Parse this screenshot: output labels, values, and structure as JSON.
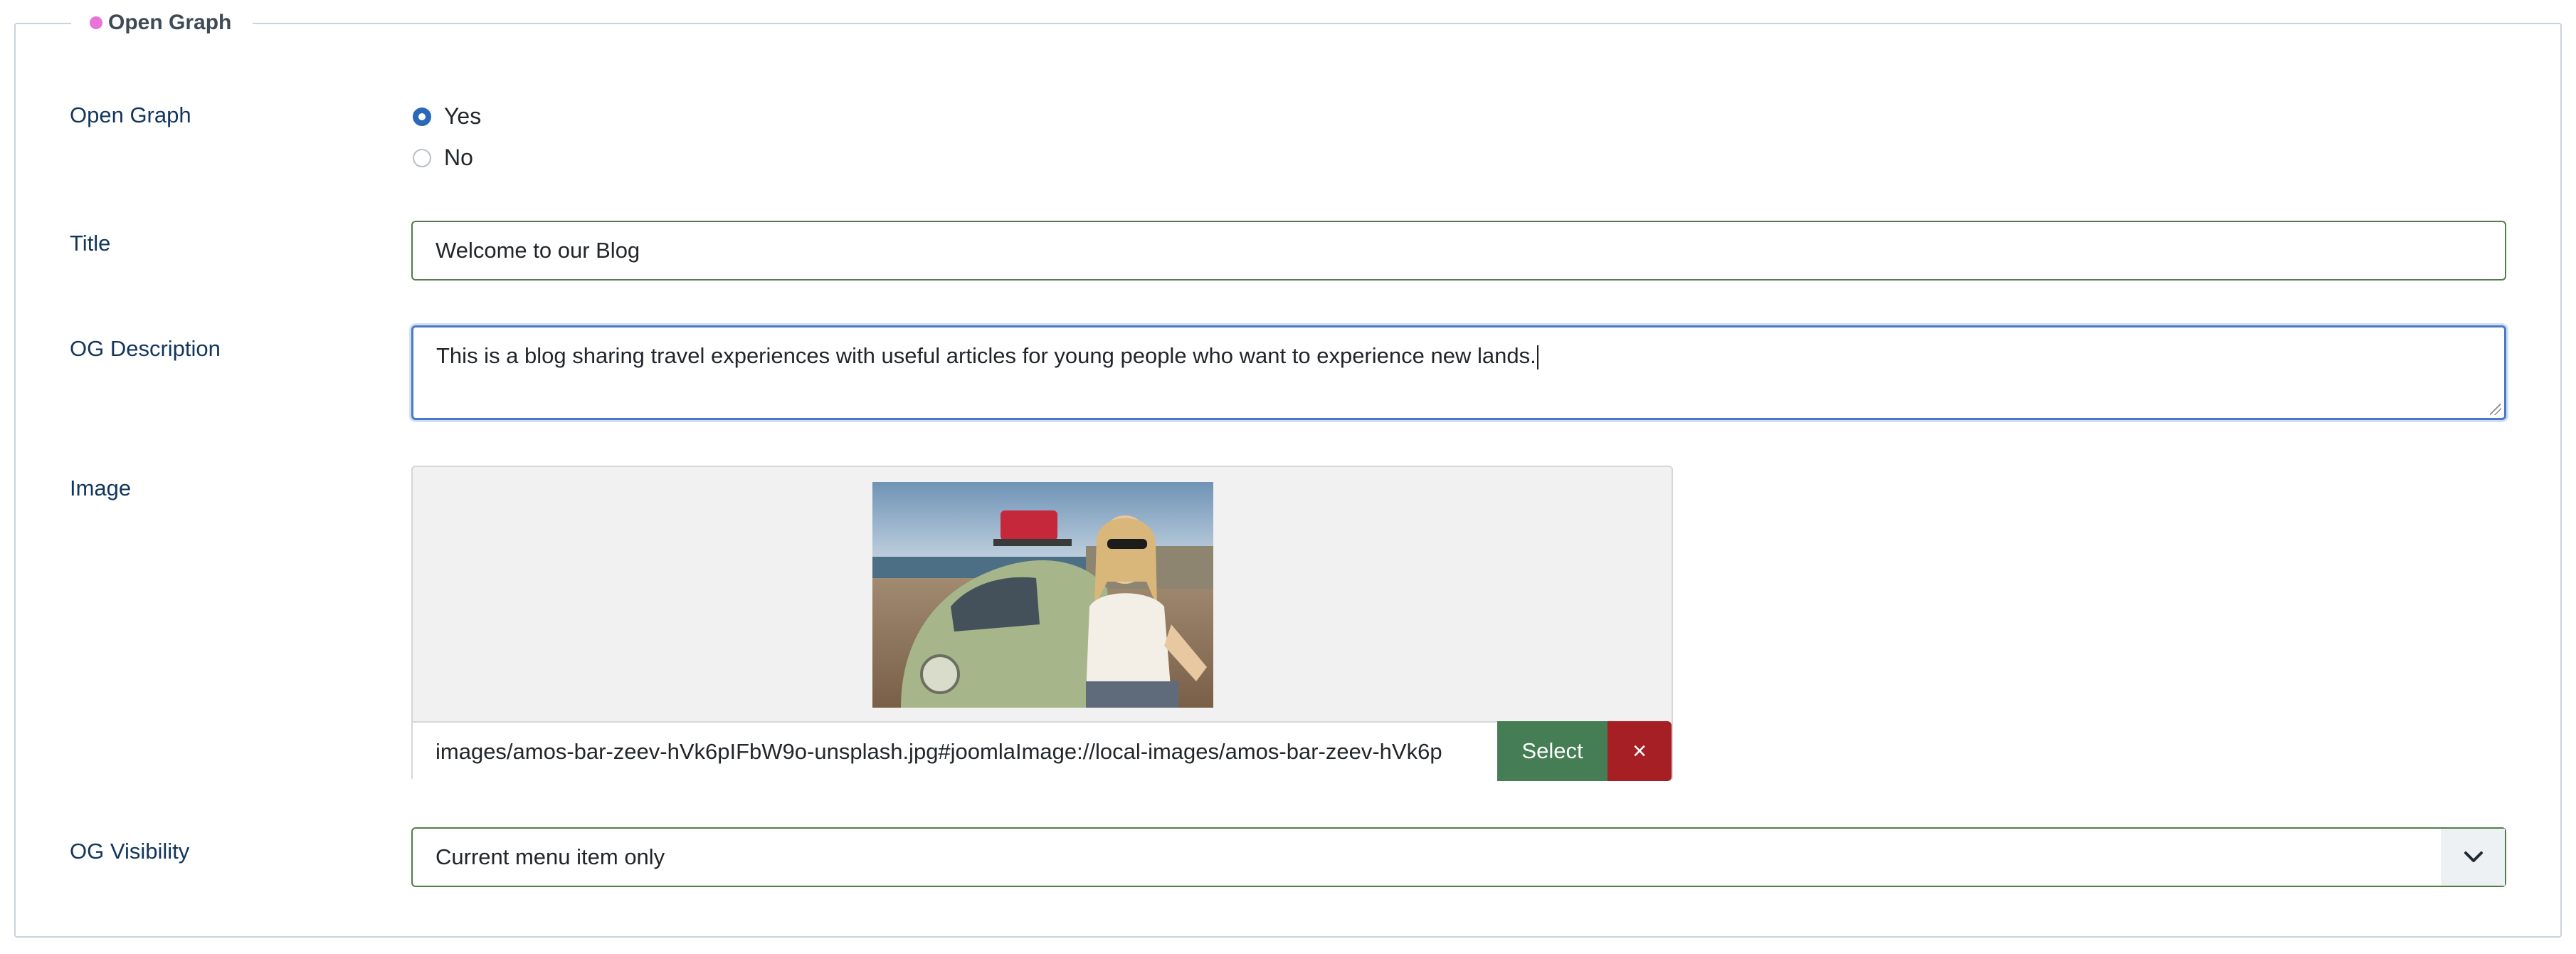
{
  "fieldset": {
    "legend": "Open Graph"
  },
  "fields": {
    "open_graph": {
      "label": "Open Graph",
      "options": [
        {
          "label": "Yes",
          "checked": true
        },
        {
          "label": "No",
          "checked": false
        }
      ]
    },
    "title": {
      "label": "Title",
      "value": "Welcome to our Blog"
    },
    "og_description": {
      "label": "OG Description",
      "value": "This is a blog sharing travel experiences with useful articles for young people who want to experience new lands."
    },
    "image": {
      "label": "Image",
      "path": "images/amos-bar-zeev-hVk6pIFbW9o-unsplash.jpg#joomlaImage://local-images/amos-bar-zeev-hVk6p",
      "select_label": "Select",
      "clear_symbol": "×",
      "preview_alt_icon": "image-preview"
    },
    "og_visibility": {
      "label": "OG Visibility",
      "value": "Current menu item only"
    }
  },
  "colors": {
    "legend_dot": "#e774d6",
    "label": "#12365c",
    "input_border": "#4f7e47",
    "radio_checked": "#2a69b8",
    "select_button": "#457d54",
    "clear_button": "#a51f24"
  }
}
